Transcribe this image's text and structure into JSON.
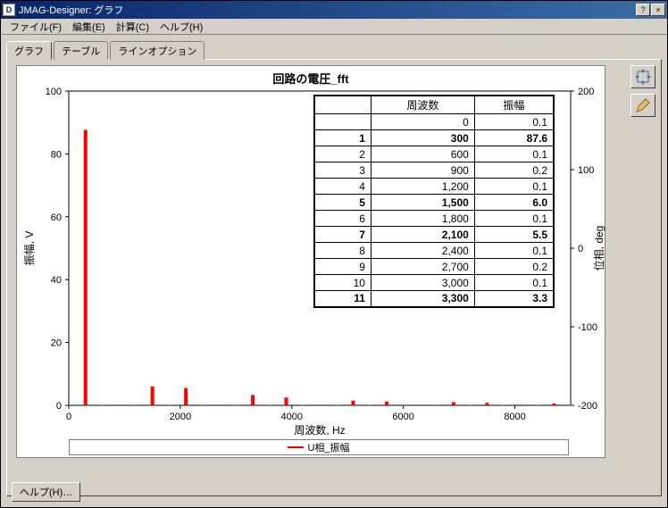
{
  "window": {
    "app_icon_letter": "D",
    "title": "JMAG-Designer: グラフ",
    "help_btn": "?",
    "close_btn": "×"
  },
  "menu": {
    "file": "ファイル(F)",
    "edit": "編集(E)",
    "calc": "計算(C)",
    "help": "ヘルプ(H)"
  },
  "tabs": {
    "graph": "グラフ",
    "table": "テーブル",
    "lineopt": "ラインオプション"
  },
  "chart_data": {
    "type": "bar",
    "title": "回路の電圧_fft",
    "xlabel": "周波数, Hz",
    "ylabel": "振幅, V",
    "ylabel2": "位相, deg",
    "xlim": [
      0,
      9000
    ],
    "ylim": [
      0,
      100
    ],
    "ylim2": [
      -200,
      200
    ],
    "xticks": [
      0,
      2000,
      4000,
      6000,
      8000
    ],
    "yticks": [
      0,
      20,
      40,
      60,
      80,
      100
    ],
    "y2ticks": [
      -200,
      -100,
      0,
      100,
      200
    ],
    "series": [
      {
        "name": "U相_振幅",
        "color": "#ff0000",
        "x": [
          0,
          300,
          600,
          900,
          1200,
          1500,
          1800,
          2100,
          2400,
          2700,
          3000,
          3300,
          3600,
          3900,
          4200,
          4500,
          4800,
          5100,
          5400,
          5700,
          6000,
          6300,
          6600,
          6900,
          7200,
          7500,
          7800,
          8100,
          8400,
          8700,
          9000
        ],
        "values": [
          0.1,
          87.6,
          0.1,
          0.2,
          0.1,
          6.0,
          0.1,
          5.5,
          0.1,
          0.2,
          0.1,
          3.3,
          0.1,
          2.5,
          0.1,
          0.2,
          0.1,
          1.5,
          0.1,
          1.2,
          0.1,
          0.2,
          0.1,
          1.0,
          0.1,
          0.8,
          0.1,
          0.2,
          0.1,
          0.6,
          0.1
        ]
      }
    ],
    "legend": [
      "U相_振幅"
    ]
  },
  "data_table": {
    "headers": [
      "",
      "周波数",
      "振幅"
    ],
    "rows": [
      {
        "idx": "",
        "freq": "0",
        "amp": "0.1",
        "bold": false
      },
      {
        "idx": "1",
        "freq": "300",
        "amp": "87.6",
        "bold": true
      },
      {
        "idx": "2",
        "freq": "600",
        "amp": "0.1",
        "bold": false
      },
      {
        "idx": "3",
        "freq": "900",
        "amp": "0.2",
        "bold": false
      },
      {
        "idx": "4",
        "freq": "1,200",
        "amp": "0.1",
        "bold": false
      },
      {
        "idx": "5",
        "freq": "1,500",
        "amp": "6.0",
        "bold": true
      },
      {
        "idx": "6",
        "freq": "1,800",
        "amp": "0.1",
        "bold": false
      },
      {
        "idx": "7",
        "freq": "2,100",
        "amp": "5.5",
        "bold": true
      },
      {
        "idx": "8",
        "freq": "2,400",
        "amp": "0.1",
        "bold": false
      },
      {
        "idx": "9",
        "freq": "2,700",
        "amp": "0.2",
        "bold": false
      },
      {
        "idx": "10",
        "freq": "3,000",
        "amp": "0.1",
        "bold": false
      },
      {
        "idx": "11",
        "freq": "3,300",
        "amp": "3.3",
        "bold": true
      }
    ]
  },
  "buttons": {
    "help": "ヘルプ(H)…"
  },
  "icons": {
    "zoom_reset": "zoom-reset-icon",
    "edit": "pencil-icon"
  }
}
